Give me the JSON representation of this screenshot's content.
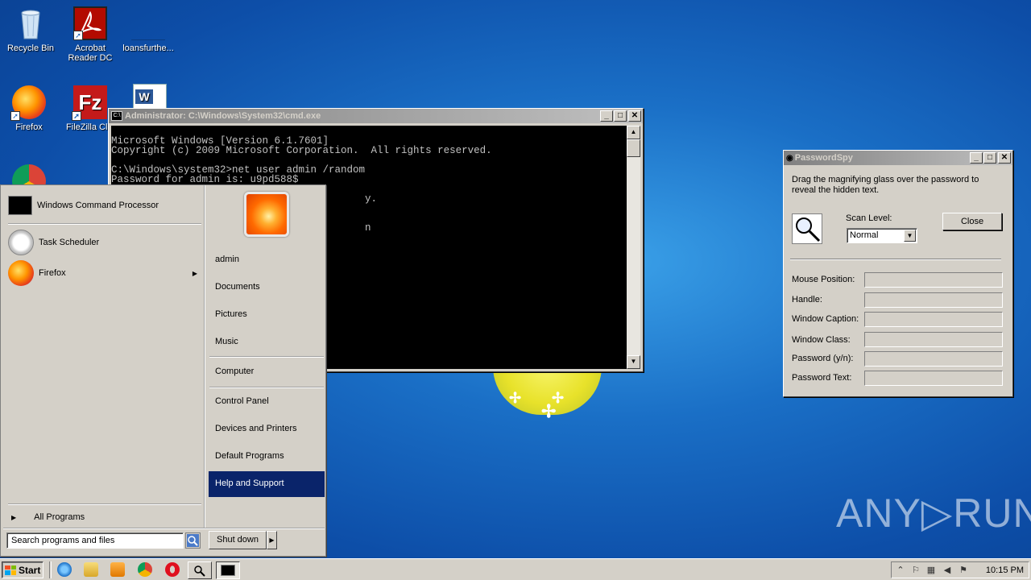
{
  "desktop": {
    "icons": [
      {
        "label": "Recycle Bin"
      },
      {
        "label": "Acrobat Reader DC"
      },
      {
        "label": "loansfurthe..."
      },
      {
        "label": "Firefox"
      },
      {
        "label": "FileZilla Clie"
      },
      {
        "label": ""
      }
    ],
    "watermark": "ANY▷RUN"
  },
  "cmd": {
    "title": "Administrator: C:\\Windows\\System32\\cmd.exe",
    "icon_text": "C:\\",
    "lines": [
      "Microsoft Windows [Version 6.1.7601]",
      "Copyright (c) 2009 Microsoft Corporation.  All rights reserved.",
      "",
      "C:\\Windows\\system32>net user admin /random",
      "Password for admin is: u9pd588$",
      "",
      "                                          y.",
      "",
      "",
      "                                          n"
    ]
  },
  "passwordspy": {
    "title": "PasswordSpy",
    "description": "Drag the magnifying glass over the password to reveal the hidden text.",
    "scan_level_label": "Scan Level:",
    "scan_level_value": "Normal",
    "close_label": "Close",
    "fields": [
      {
        "label": "Mouse Position:",
        "value": ""
      },
      {
        "label": "Handle:",
        "value": ""
      },
      {
        "label": "Window Caption:",
        "value": ""
      },
      {
        "label": "Window Class:",
        "value": ""
      },
      {
        "label": "Password (y/n):",
        "value": ""
      },
      {
        "label": "Password Text:",
        "value": ""
      }
    ]
  },
  "start_menu": {
    "pinned": [
      {
        "label": "Windows Command Processor"
      },
      {
        "label": "Task Scheduler"
      },
      {
        "label": "Firefox",
        "has_submenu": true
      }
    ],
    "all_programs": "All Programs",
    "search_placeholder": "Search programs and files",
    "right_items": [
      {
        "label": "admin"
      },
      {
        "label": "Documents"
      },
      {
        "label": "Pictures"
      },
      {
        "label": "Music"
      },
      {
        "label": "Computer"
      },
      {
        "label": "Control Panel"
      },
      {
        "label": "Devices and Printers"
      },
      {
        "label": "Default Programs"
      },
      {
        "label": "Help and Support",
        "highlighted": true
      }
    ],
    "shutdown_label": "Shut down"
  },
  "taskbar": {
    "start_label": "Start",
    "clock": "10:15 PM",
    "quick_launch": [
      "internet-explorer-icon",
      "explorer-folder-icon",
      "media-player-icon",
      "chrome-icon",
      "opera-icon"
    ],
    "tasks": [
      "passwordspy-task",
      "cmd-task"
    ]
  },
  "colors": {
    "titlebar_active": "#0a246a",
    "highlight": "#0a246a",
    "desktop_blue": "#1a6fc6"
  }
}
